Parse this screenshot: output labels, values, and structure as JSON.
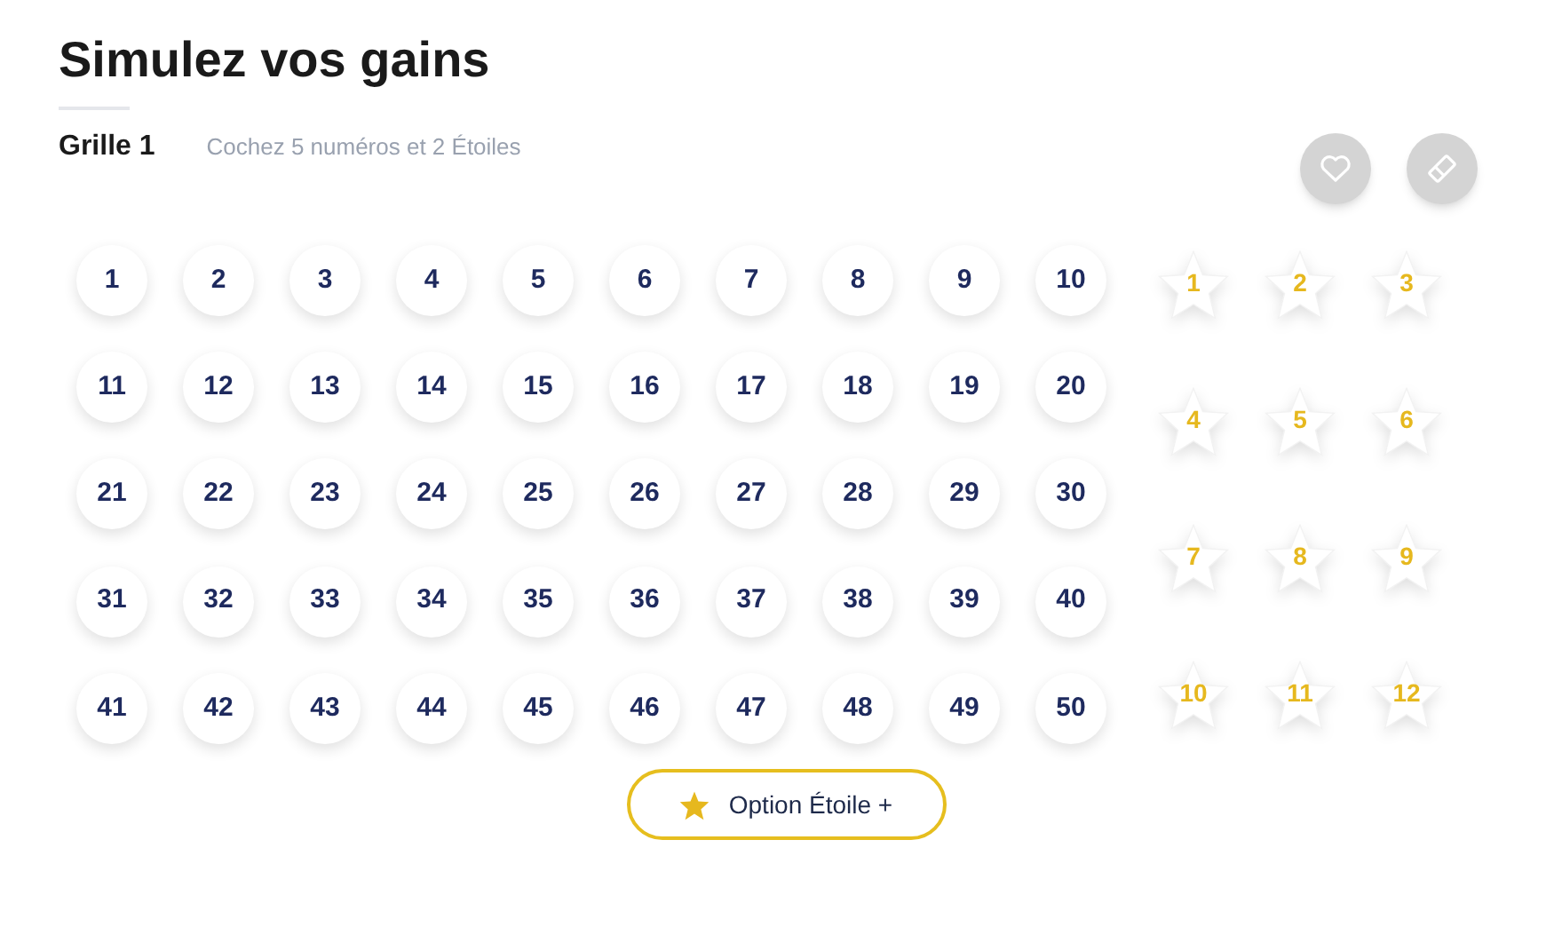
{
  "title": "Simulez vos gains",
  "grid": {
    "label": "Grille 1",
    "hint": "Cochez 5 numéros et 2 Étoiles"
  },
  "numbers": [
    {
      "label": "1",
      "selected": false
    },
    {
      "label": "2",
      "selected": false
    },
    {
      "label": "3",
      "selected": false
    },
    {
      "label": "4",
      "selected": false
    },
    {
      "label": "5",
      "selected": false
    },
    {
      "label": "6",
      "selected": false
    },
    {
      "label": "7",
      "selected": false
    },
    {
      "label": "8",
      "selected": false
    },
    {
      "label": "9",
      "selected": false
    },
    {
      "label": "10",
      "selected": false
    },
    {
      "label": "11",
      "selected": false
    },
    {
      "label": "12",
      "selected": false
    },
    {
      "label": "13",
      "selected": false
    },
    {
      "label": "14",
      "selected": false
    },
    {
      "label": "15",
      "selected": false
    },
    {
      "label": "16",
      "selected": false
    },
    {
      "label": "17",
      "selected": false
    },
    {
      "label": "18",
      "selected": false
    },
    {
      "label": "19",
      "selected": false
    },
    {
      "label": "20",
      "selected": false
    },
    {
      "label": "21",
      "selected": false
    },
    {
      "label": "22",
      "selected": false
    },
    {
      "label": "23",
      "selected": false
    },
    {
      "label": "24",
      "selected": false
    },
    {
      "label": "25",
      "selected": false
    },
    {
      "label": "26",
      "selected": false
    },
    {
      "label": "27",
      "selected": false
    },
    {
      "label": "28",
      "selected": false
    },
    {
      "label": "29",
      "selected": false
    },
    {
      "label": "30",
      "selected": false
    },
    {
      "label": "31",
      "selected": false
    },
    {
      "label": "32",
      "selected": false
    },
    {
      "label": "33",
      "selected": false
    },
    {
      "label": "34",
      "selected": false
    },
    {
      "label": "35",
      "selected": false
    },
    {
      "label": "36",
      "selected": false
    },
    {
      "label": "37",
      "selected": false
    },
    {
      "label": "38",
      "selected": false
    },
    {
      "label": "39",
      "selected": false
    },
    {
      "label": "40",
      "selected": false
    },
    {
      "label": "41",
      "selected": false
    },
    {
      "label": "42",
      "selected": false
    },
    {
      "label": "43",
      "selected": false
    },
    {
      "label": "44",
      "selected": false
    },
    {
      "label": "45",
      "selected": false
    },
    {
      "label": "46",
      "selected": false
    },
    {
      "label": "47",
      "selected": false
    },
    {
      "label": "48",
      "selected": false
    },
    {
      "label": "49",
      "selected": false
    },
    {
      "label": "50",
      "selected": false
    }
  ],
  "stars": [
    {
      "label": "1",
      "selected": false
    },
    {
      "label": "2",
      "selected": false
    },
    {
      "label": "3",
      "selected": false
    },
    {
      "label": "4",
      "selected": false
    },
    {
      "label": "5",
      "selected": false
    },
    {
      "label": "6",
      "selected": false
    },
    {
      "label": "7",
      "selected": false
    },
    {
      "label": "8",
      "selected": false
    },
    {
      "label": "9",
      "selected": false
    },
    {
      "label": "10",
      "selected": false
    },
    {
      "label": "11",
      "selected": false
    },
    {
      "label": "12",
      "selected": false
    }
  ],
  "option_button": {
    "label": "Option Étoile +"
  }
}
